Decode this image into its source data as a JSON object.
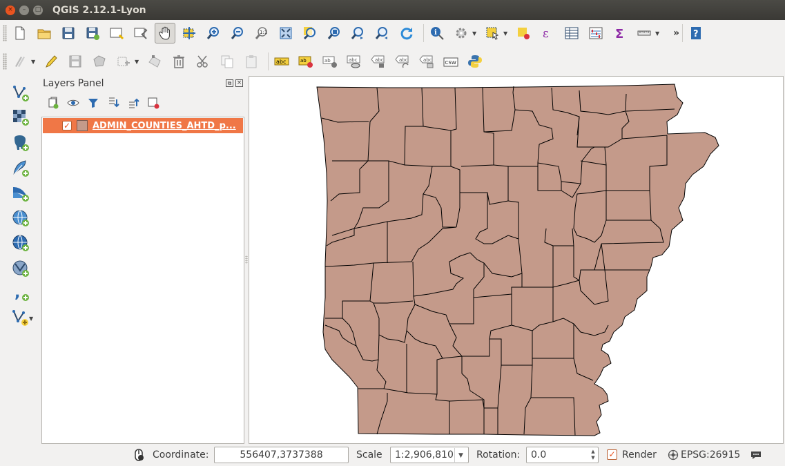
{
  "window": {
    "title": "QGIS 2.12.1-Lyon",
    "buttons": {
      "close": "×",
      "minimize": "–",
      "maximize": "□"
    }
  },
  "toolbar_main": {
    "items": [
      "new-project",
      "open-project",
      "save-project",
      "save-as",
      "new-print-composer",
      "composer-manager",
      "pan-map",
      "pan-to-selection",
      "zoom-in",
      "zoom-out",
      "zoom-native",
      "zoom-full",
      "zoom-to-selection",
      "zoom-to-layer",
      "zoom-last",
      "zoom-next",
      "refresh",
      "identify",
      "run-feature-action",
      "select-features",
      "deselect-all",
      "field-calculator",
      "attribute-table",
      "statistical-summary",
      "sum",
      "measure",
      "more"
    ],
    "more_label": "»"
  },
  "toolbar_digitize": {
    "items": [
      "current-edits",
      "toggle-editing",
      "save-edits",
      "add-feature",
      "move-feature",
      "node-tool",
      "delete-selected",
      "cut-features",
      "copy-features",
      "paste-features"
    ],
    "label_tools": [
      "abc",
      "ab",
      "ab",
      "abc",
      "abc",
      "abc",
      "abc"
    ],
    "csw_label": "CSW"
  },
  "left_toolbar": {
    "items": [
      "add-vector-layer",
      "add-raster-layer",
      "add-postgis-layer",
      "add-spatialite-layer",
      "add-mssql-layer",
      "add-wms-layer",
      "add-wcs-layer",
      "add-wfs-layer",
      "add-delimited-text-layer",
      "new-shapefile-layer"
    ]
  },
  "layers_panel": {
    "title": "Layers Panel",
    "float_label": "⧉",
    "close_label": "×",
    "tools": [
      "add-group",
      "manage-visibility",
      "filter-legend",
      "expand-all",
      "collapse-all",
      "remove-layer"
    ],
    "layers": [
      {
        "name": "ADMIN_COUNTIES_AHTD_p...",
        "visible": true,
        "color": "#c49a8a",
        "selected": true
      }
    ]
  },
  "map": {
    "fill": "#c49a8a",
    "stroke": "#000000",
    "background": "#ffffff"
  },
  "statusbar": {
    "coordinate_label": "Coordinate:",
    "coordinate_value": "556407,3737388",
    "scale_label": "Scale",
    "scale_value": "1:2,906,810",
    "rotation_label": "Rotation:",
    "rotation_value": "0.0",
    "render_label": "Render",
    "render_checked": true,
    "crs": "EPSG:26915"
  },
  "colors": {
    "accent": "#e95420",
    "selection": "#f07746",
    "titlebar": "#3c3b37"
  }
}
